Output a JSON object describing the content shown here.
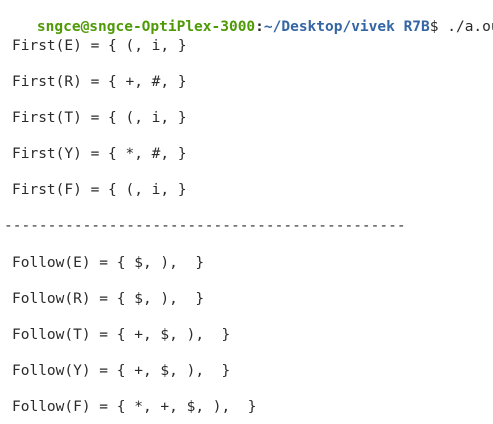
{
  "prompt": {
    "user_host": "sngce@sngce-OptiPlex-3000",
    "colon": ":",
    "path": "~/Desktop/vivek R7B",
    "dollar": "$",
    "command": " ./a.out"
  },
  "first_sets": [
    "First(E) = { (, i, }",
    "First(R) = { +, #, }",
    "First(T) = { (, i, }",
    "First(Y) = { *, #, }",
    "First(F) = { (, i, }"
  ],
  "separator": "----------------------------------------------",
  "follow_sets": [
    "Follow(E) = { $, ),  }",
    "Follow(R) = { $, ),  }",
    "Follow(T) = { +, $, ),  }",
    "Follow(Y) = { +, $, ),  }",
    "Follow(F) = { *, +, $, ),  }"
  ]
}
